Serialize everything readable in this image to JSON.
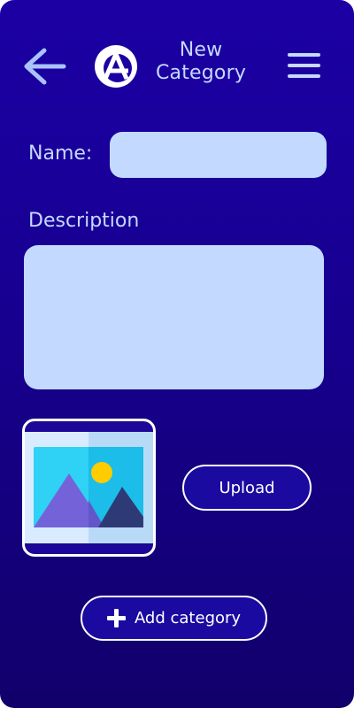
{
  "header": {
    "title_line1": "New",
    "title_line2": "Category"
  },
  "icons": {
    "back": "arrow-left-icon",
    "logo": "app-logo",
    "menu": "hamburger-menu-icon",
    "image": "image-placeholder-icon",
    "add": "plus-icon"
  },
  "form": {
    "name_label": "Name:",
    "name_value": "",
    "name_placeholder": "",
    "description_label": "Description",
    "description_value": "",
    "description_placeholder": ""
  },
  "image_section": {
    "upload_label": "Upload"
  },
  "actions": {
    "add_category_label": "Add category"
  },
  "colors": {
    "background_top": "#1c00a4",
    "background_bottom": "#11006b",
    "text": "#c7d8ff",
    "input_bg": "#c3d9ff",
    "button_bg": "#1a0aa0",
    "button_border": "#ffffff"
  }
}
